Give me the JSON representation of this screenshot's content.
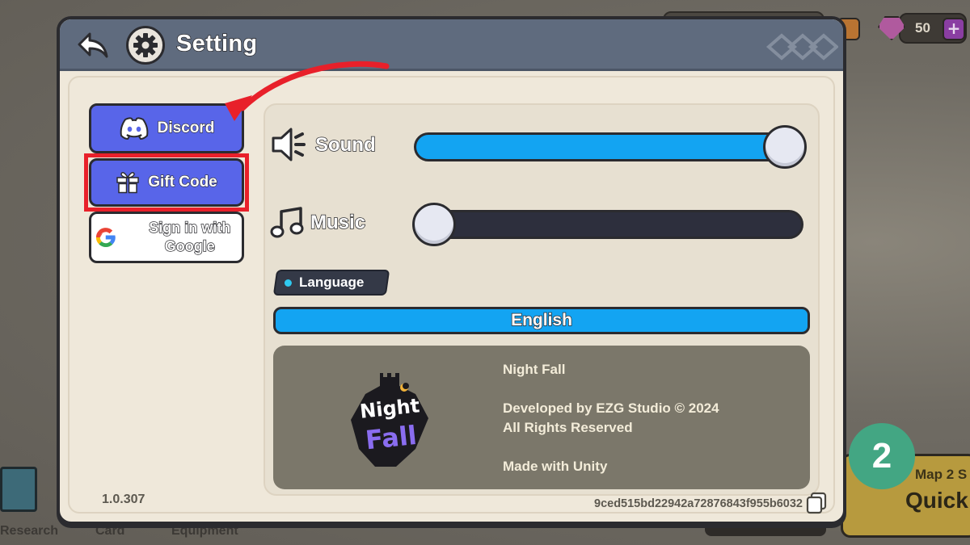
{
  "background": {
    "gem_count": "50",
    "plus_label": "+",
    "nav_labels": [
      "Research",
      "Card",
      "Equipment"
    ],
    "map_card": {
      "title": "Map 2 S",
      "action": "Quick"
    },
    "step_badge": "2"
  },
  "dialog": {
    "title": "Setting",
    "back_icon": "back-arrow-icon",
    "title_icon": "gear-icon"
  },
  "sidebar": {
    "discord_label": "Discord",
    "gift_code_label": "Gift Code",
    "google_label_line1": "Sign in with",
    "google_label_line2": "Google"
  },
  "settings": {
    "sound": {
      "label": "Sound",
      "level": 1.0
    },
    "music": {
      "label": "Music",
      "level": 0.0
    },
    "language_tag": "Language",
    "language_value": "English"
  },
  "about": {
    "game_name": "Night Fall",
    "developer": "Developed by EZG Studio © 2024",
    "rights": "All Rights Reserved",
    "engine": "Made with Unity",
    "logo_line1": "Night",
    "logo_line2": "Fall"
  },
  "footer": {
    "version": "1.0.307",
    "device_id": "9ced515bd22942a72876843f955b6032"
  },
  "colors": {
    "discord": "#5865e9",
    "slider_fill": "#13a4f2",
    "highlight": "#e8202a",
    "header": "#5f6b7e"
  }
}
